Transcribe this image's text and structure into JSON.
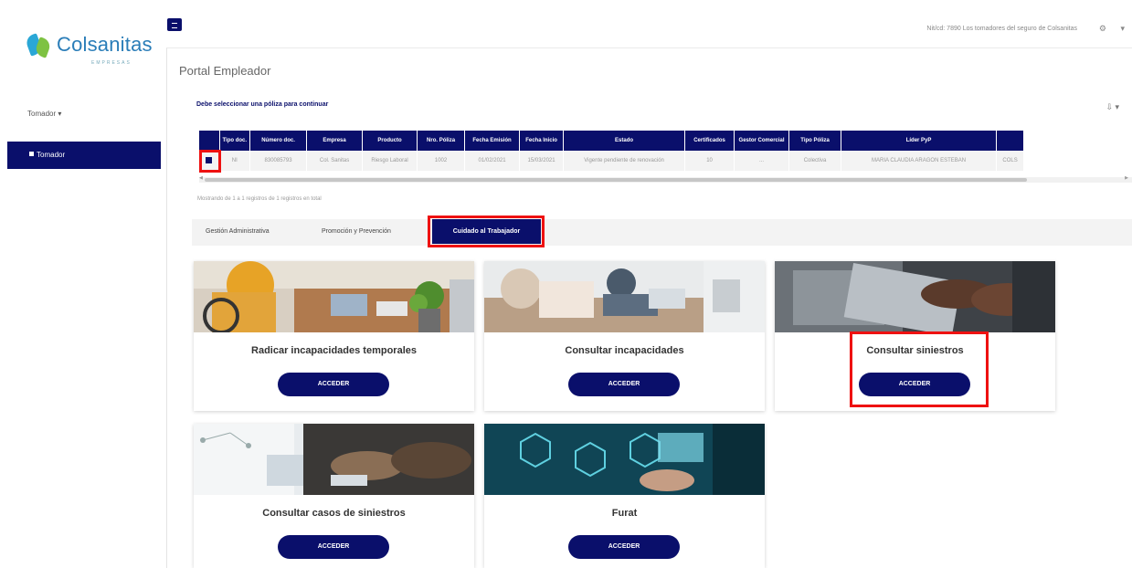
{
  "brand": {
    "name": "Colsanitas",
    "tagline": "EMPRESAS"
  },
  "sidebar": {
    "select_label": "Tomador ▾",
    "active_item": "Tomador"
  },
  "topbar": {
    "user_text": "Nit/cd: 7890 Los tomadores del seguro de Colsanitas",
    "icon1": "⚙",
    "icon2": "▾"
  },
  "page_title": "Portal Empleador",
  "policy_note": "Debe seleccionar una póliza para continuar",
  "export_icon": "⇩ ▾",
  "table": {
    "headers": [
      "",
      "Tipo doc.",
      "Número doc.",
      "Empresa",
      "Producto",
      "Nro. Póliza",
      "Fecha Emisión",
      "Fecha Inicio",
      "Estado",
      "Certificados",
      "Gestor Comercial",
      "Tipo Póliza",
      "Líder PyP",
      ""
    ],
    "row": [
      "",
      "NI",
      "830085793",
      "Col. Sanitas",
      "Riesgo Laboral",
      "1002",
      "01/02/2021",
      "15/03/2021",
      "Vigente pendiente de renovación",
      "10",
      "...",
      "Colectiva",
      "MARIA CLAUDIA ARAGON ESTEBAN",
      "COLS"
    ]
  },
  "records_text": "Mostrando de 1 a 1 registros de 1 registros en total",
  "tabs": {
    "tab1": "Gestión Administrativa",
    "tab2": "Promoción y Prevención",
    "tab3": "Cuidado al Trabajador"
  },
  "cards": [
    {
      "title": "Radicar incapacidades temporales",
      "button": "ACCEDER"
    },
    {
      "title": "Consultar incapacidades",
      "button": "ACCEDER"
    },
    {
      "title": "Consultar siniestros",
      "button": "ACCEDER"
    },
    {
      "title": "Consultar casos de siniestros",
      "button": "ACCEDER"
    },
    {
      "title": "Furat",
      "button": "ACCEDER"
    }
  ],
  "colors": {
    "primary": "#0a0f6b",
    "highlight": "#ee1111",
    "brand_blue": "#2a7db8",
    "brand_green": "#7ec242"
  }
}
